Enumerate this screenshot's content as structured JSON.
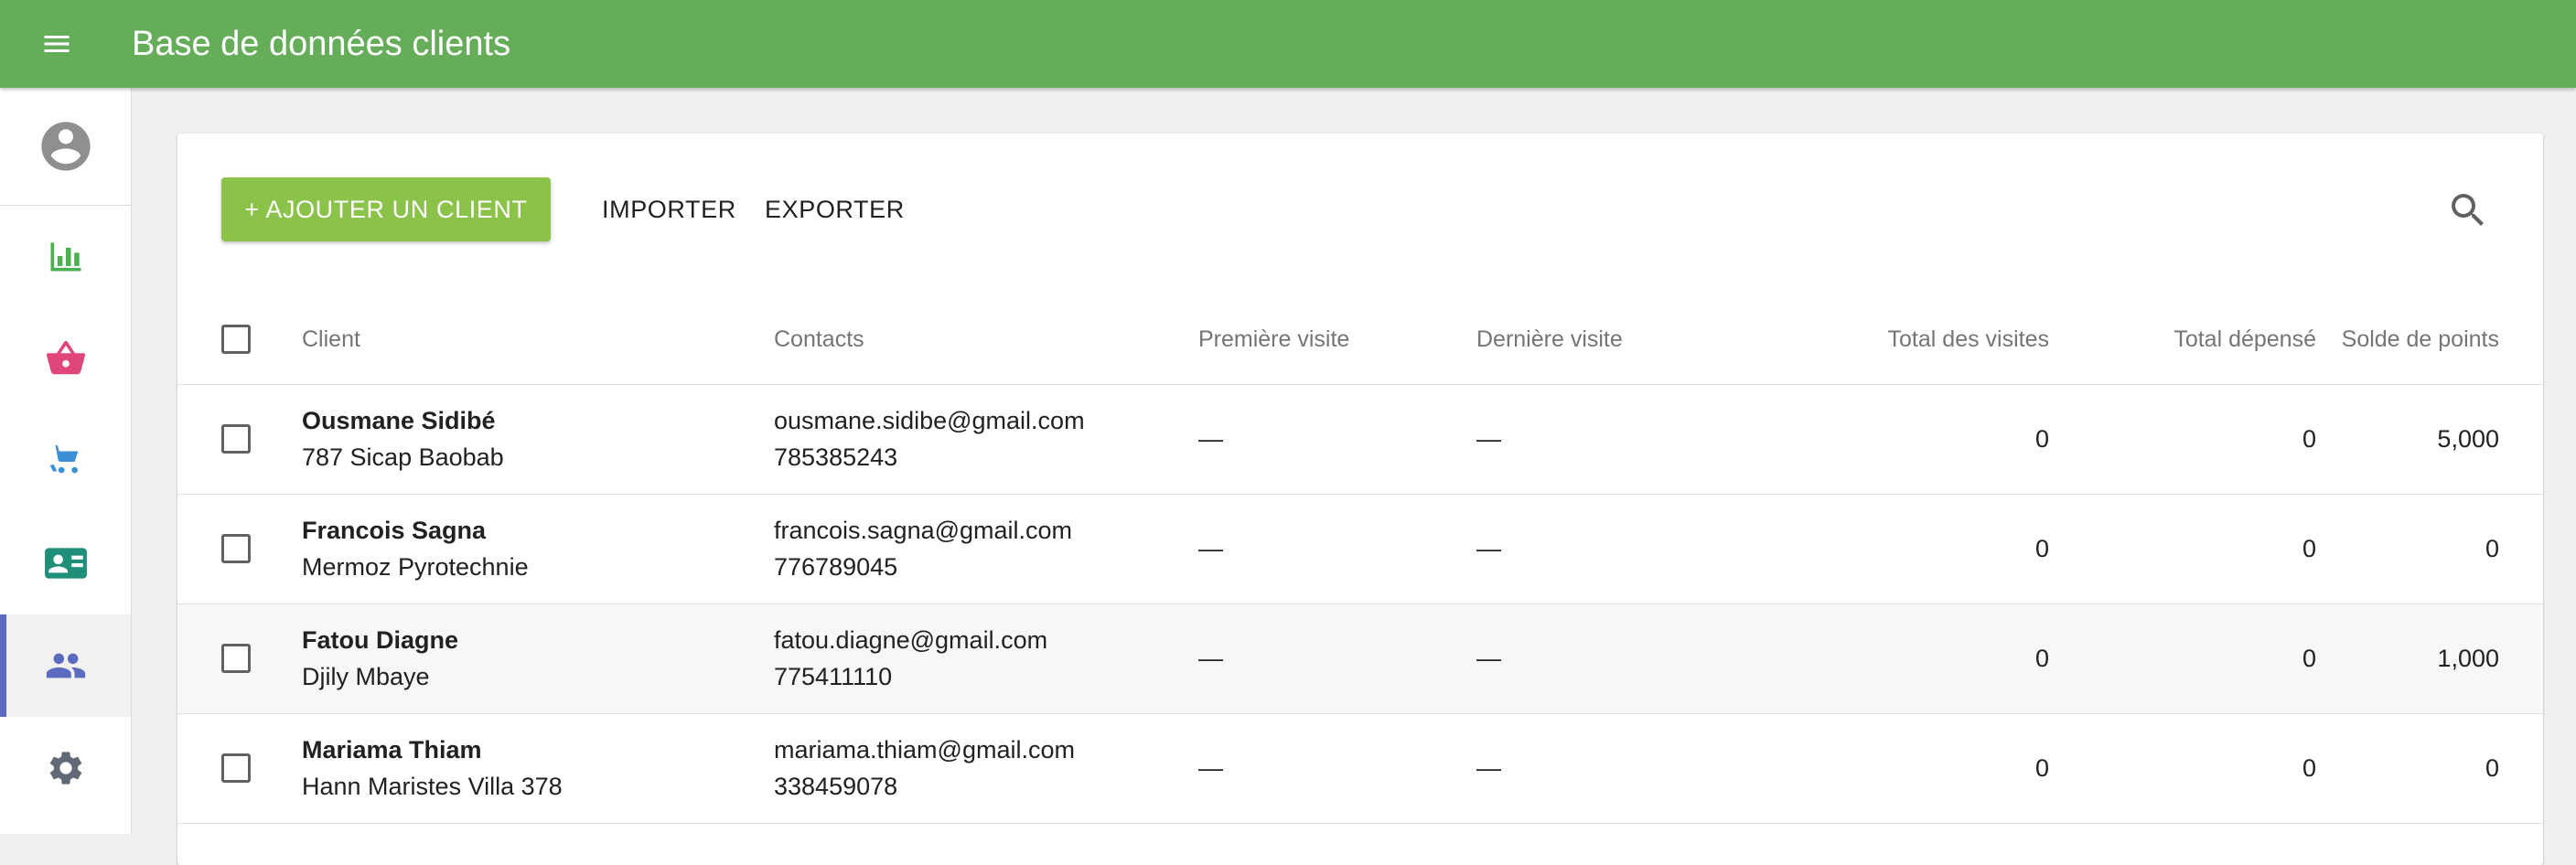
{
  "app": {
    "title": "Base de données clients",
    "brand_color": "#66ad5a",
    "accent_button_color": "#8bc34a",
    "active_indicator_color": "#5c6bc0"
  },
  "header": {
    "menu_icon": "menu-icon"
  },
  "sidebar": {
    "avatar_icon": "account-circle-icon",
    "items": [
      {
        "icon": "bar-chart-icon",
        "color": "#4caf50",
        "active": false
      },
      {
        "icon": "basket-icon",
        "color": "#e0457b",
        "active": false
      },
      {
        "icon": "cart-icon",
        "color": "#3d8fd6",
        "active": false
      },
      {
        "icon": "contact-card-icon",
        "color": "#1f8f7a",
        "active": false
      },
      {
        "icon": "people-icon",
        "color": "#5c6bc0",
        "active": true
      },
      {
        "icon": "gear-icon",
        "color": "#616b78",
        "active": false
      }
    ]
  },
  "toolbar": {
    "add_label": "+ AJOUTER UN CLIENT",
    "import_label": "IMPORTER",
    "export_label": "EXPORTER",
    "search_icon": "search-icon"
  },
  "table": {
    "columns": {
      "client": "Client",
      "contacts": "Contacts",
      "first_visit": "Première visite",
      "last_visit": "Dernière visite",
      "total_visits": "Total des visites",
      "total_spent": "Total dépensé",
      "points": "Solde de points"
    },
    "rows": [
      {
        "name": "Ousmane Sidibé",
        "address": "787 Sicap Baobab",
        "email": "ousmane.sidibe@gmail.com",
        "phone": "785385243",
        "first_visit": "—",
        "last_visit": "—",
        "total_visits": "0",
        "total_spent": "0",
        "points": "5,000"
      },
      {
        "name": "Francois Sagna",
        "address": "Mermoz Pyrotechnie",
        "email": "francois.sagna@gmail.com",
        "phone": "776789045",
        "first_visit": "—",
        "last_visit": "—",
        "total_visits": "0",
        "total_spent": "0",
        "points": "0"
      },
      {
        "name": "Fatou Diagne",
        "address": "Djily Mbaye",
        "email": "fatou.diagne@gmail.com",
        "phone": "775411110",
        "first_visit": "—",
        "last_visit": "—",
        "total_visits": "0",
        "total_spent": "0",
        "points": "1,000"
      },
      {
        "name": "Mariama Thiam",
        "address": "Hann Maristes Villa 378",
        "email": "mariama.thiam@gmail.com",
        "phone": "338459078",
        "first_visit": "—",
        "last_visit": "—",
        "total_visits": "0",
        "total_spent": "0",
        "points": "0"
      }
    ]
  }
}
